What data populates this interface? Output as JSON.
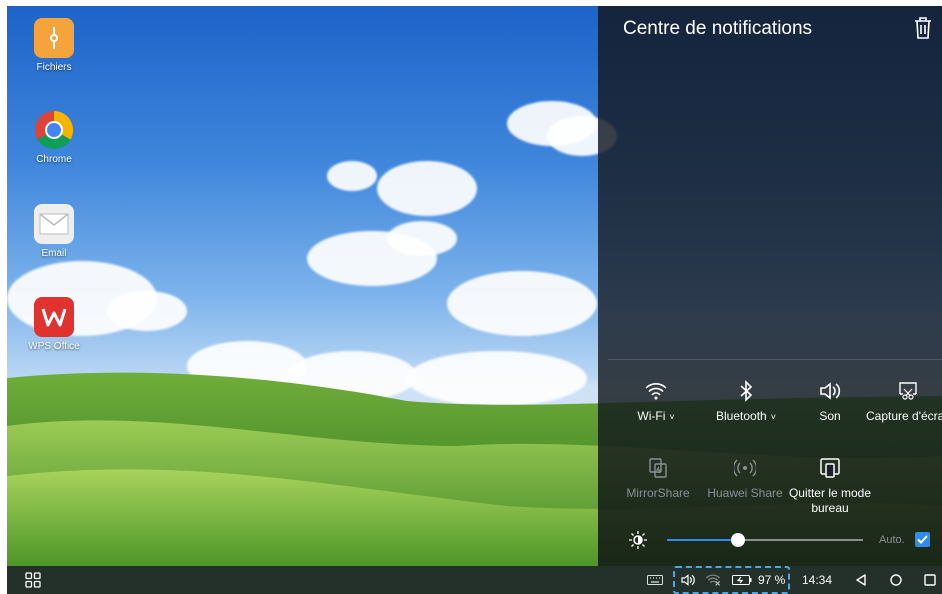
{
  "desktop": {
    "icons": [
      {
        "label": "Fichiers",
        "icon": "folder-zip-icon"
      },
      {
        "label": "Chrome",
        "icon": "chrome-icon"
      },
      {
        "label": "Email",
        "icon": "mail-icon"
      },
      {
        "label": "WPS Office",
        "icon": "wps-office-icon"
      }
    ]
  },
  "notification_panel": {
    "title": "Centre de notifications",
    "clear_icon": "trash-icon",
    "quick_settings": [
      {
        "label": "Wi-Fi",
        "icon": "wifi-icon",
        "active": true,
        "has_chevron": true,
        "chevron": "˅"
      },
      {
        "label": "Bluetooth",
        "icon": "bluetooth-icon",
        "active": true,
        "has_chevron": true,
        "chevron": "˅"
      },
      {
        "label": "Son",
        "icon": "speaker-icon",
        "active": true
      },
      {
        "label": "Capture d'écran",
        "icon": "screenshot-icon",
        "active": true
      },
      {
        "label": "MirrorShare",
        "icon": "mirrorshare-icon",
        "active": false
      },
      {
        "label": "Huawei Share",
        "icon": "huawei-share-icon",
        "active": false
      },
      {
        "label": "Quitter le mode bureau",
        "icon": "exit-desktop-icon",
        "active": true
      }
    ],
    "brightness": {
      "level": 0.36,
      "auto_label": "Auto.",
      "auto_checked": true
    }
  },
  "taskbar": {
    "battery_percent": "97 %",
    "time": "14:34",
    "colors": {
      "accent": "#2e8cf0",
      "taskbar_bg": "#24302a"
    }
  }
}
